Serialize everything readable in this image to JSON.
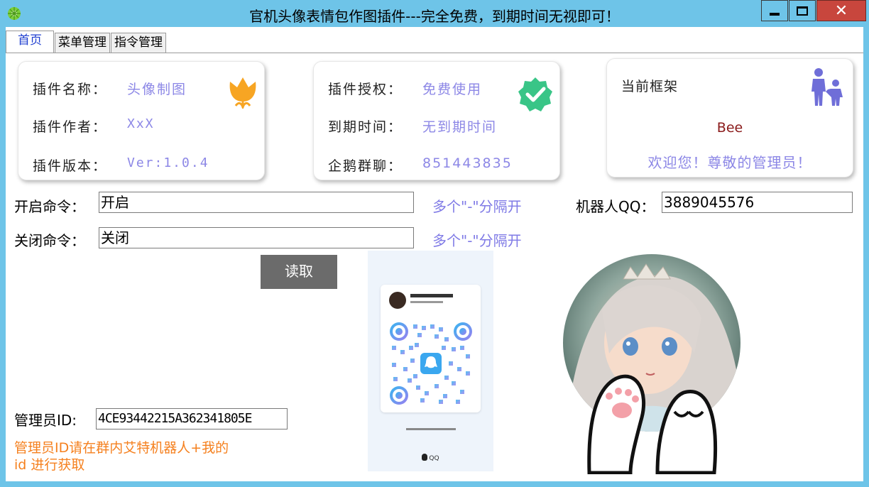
{
  "window": {
    "title": "官机头像表情包作图插件---完全免费，到期时间无视即可！",
    "minimize_glyph": "▬",
    "maximize_glyph": "□",
    "close_glyph": "✕",
    "accent": "#6ec4e8"
  },
  "tabs": [
    {
      "label": "首页"
    },
    {
      "label": "菜单管理"
    },
    {
      "label": "指令管理"
    }
  ],
  "card_plugin": {
    "name_label": "插件名称：",
    "name_value": "头像制图",
    "author_label": "插件作者：",
    "author_value": "XxX",
    "version_label": "插件版本：",
    "version_value": "Ver:1.0.4",
    "icon": "tulip-icon"
  },
  "card_license": {
    "auth_label": "插件授权：",
    "auth_value": "免费使用",
    "expire_label": "到期时间：",
    "expire_value": "无到期时间",
    "group_label": "企鹅群聊：",
    "group_value": "851443835",
    "icon": "verified-badge-icon"
  },
  "card_framework": {
    "label": "当前框架",
    "name": "Bee",
    "welcome": "欢迎您！尊敬的管理员！",
    "icon": "parent-child-icon"
  },
  "form": {
    "open_label": "开启命令：",
    "open_value": "开启",
    "close_label": "关闭命令：",
    "close_value": "关闭",
    "hint": "多个\"-\"分隔开",
    "robot_label": "机器人QQ：",
    "robot_value": "3889045576",
    "read_button": "读取",
    "admin_label": "管理员ID:",
    "admin_value": "4CE93442215A362341805E",
    "admin_note_1": "管理员ID请在群内艾特机器人+我的",
    "admin_note_2": "id 进行获取"
  },
  "qr_card": {
    "footer": "QQ"
  }
}
